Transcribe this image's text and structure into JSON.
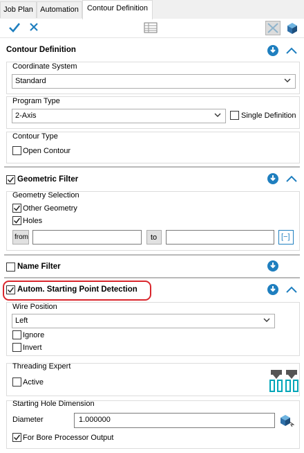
{
  "tabs": [
    {
      "label": "Job Plan",
      "active": false
    },
    {
      "label": "Automation",
      "active": false
    },
    {
      "label": "Contour Definition",
      "active": true
    }
  ],
  "toolbar": {
    "icons": [
      "checkmark-icon",
      "close-icon",
      "table-icon",
      "grid-disabled-icon",
      "cube-icon"
    ]
  },
  "contour_definition": {
    "title": "Contour Definition",
    "coordinate_system": {
      "label": "Coordinate System",
      "value": "Standard"
    },
    "program_type": {
      "label": "Program Type",
      "value": "2-Axis",
      "single_definition": "Single Definition",
      "single_definition_checked": false
    },
    "contour_type": {
      "label": "Contour Type",
      "open_contour": "Open Contour",
      "open_contour_checked": false
    }
  },
  "geometric_filter": {
    "title": "Geometric Filter",
    "checked": true,
    "geometry_selection": "Geometry Selection",
    "other_geometry": "Other Geometry",
    "other_geometry_checked": true,
    "holes": "Holes",
    "holes_checked": true,
    "from_label": "from",
    "from_value": "",
    "to_label": "to",
    "to_value": "",
    "range_button": "[−]"
  },
  "name_filter": {
    "title": "Name Filter",
    "checked": false
  },
  "starting_point": {
    "title": "Autom. Starting Point Detection",
    "checked": true,
    "wire_position": {
      "label": "Wire Position",
      "value": "Left"
    },
    "ignore": "Ignore",
    "ignore_checked": false,
    "invert": "Invert",
    "invert_checked": false
  },
  "threading_expert": {
    "label": "Threading Expert",
    "active": "Active",
    "active_checked": false
  },
  "starting_hole": {
    "label": "Starting Hole Dimension",
    "diameter_label": "Diameter",
    "diameter_value": "1.000000",
    "bore_processor": "For Bore Processor Output",
    "bore_processor_checked": true
  },
  "colors": {
    "accent": "#1f7fbf",
    "highlight": "#d9262c",
    "teal": "#00a6b8"
  }
}
